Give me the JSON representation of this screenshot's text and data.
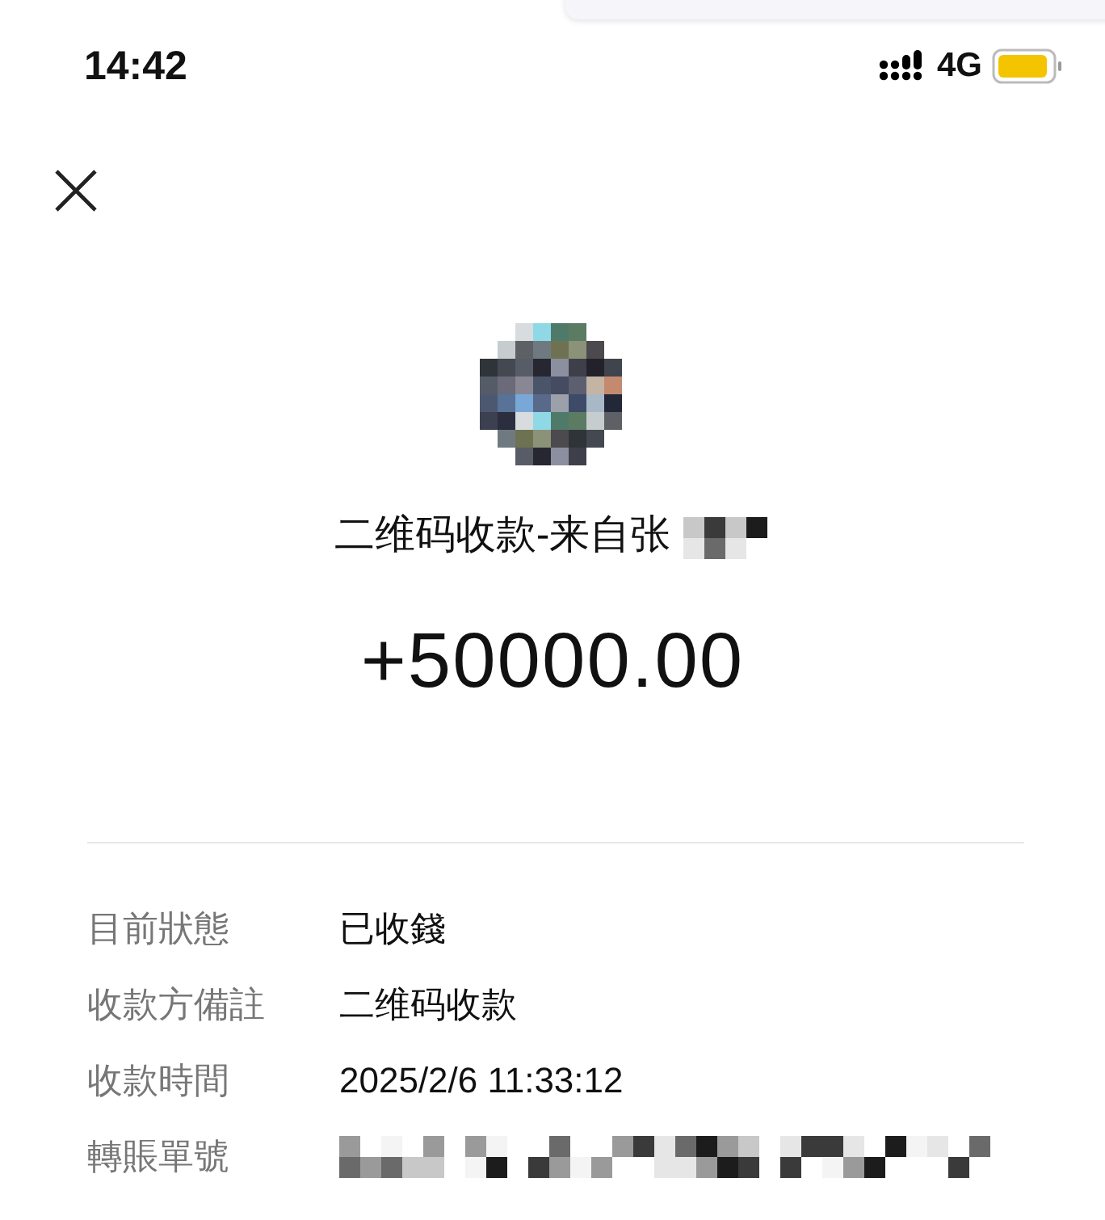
{
  "status_bar": {
    "time": "14:42",
    "network": "4G"
  },
  "header": {
    "title": "二维码收款-来自张",
    "amount": "+50000.00"
  },
  "details": [
    {
      "label": "目前狀態",
      "value": "已收錢"
    },
    {
      "label": "收款方備註",
      "value": "二维码收款"
    },
    {
      "label": "收款時間",
      "value": "2025/2/6 11:33:12"
    },
    {
      "label": "轉賬單號",
      "kind": "redacted"
    }
  ]
}
